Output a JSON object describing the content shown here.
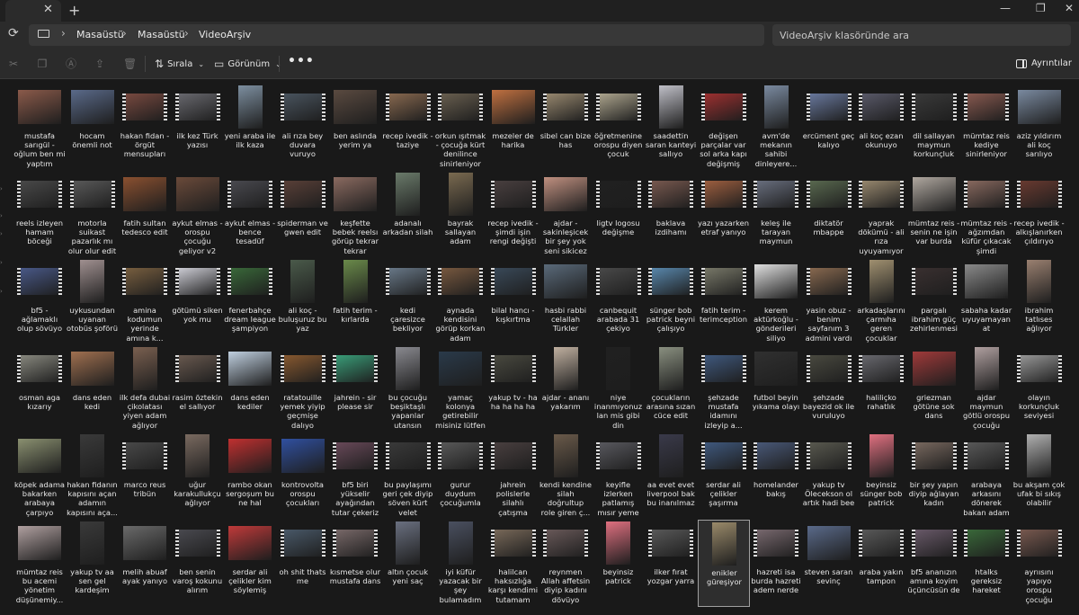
{
  "window": {
    "tab_close": "✕",
    "new_tab": "+",
    "minimize": "—",
    "maximize": "❐",
    "close": "✕"
  },
  "nav": {
    "breadcrumbs": [
      "Masaüstü",
      "Masaüstü",
      "VideoArşiv"
    ],
    "search_placeholder": "VideoArşiv klasöründe ara"
  },
  "toolbar": {
    "sort_label": "Sırala",
    "view_label": "Görünüm",
    "more_label": "•••",
    "details_label": "Ayrıntılar"
  },
  "colors": {
    "background": "#191919",
    "toolbar": "#2b2b2b",
    "address": "#383838",
    "selected_border": "#a0a0a0"
  },
  "files": [
    {
      "name": "mustafa sarıgül - oğlum ben mi yaptım",
      "color": "#8b5a4a",
      "shape": "wide"
    },
    {
      "name": "hocam önemli not",
      "color": "#5a6a8a",
      "shape": "wide"
    },
    {
      "name": "hakan fidan - örgüt mensupları",
      "color": "#7a4a40",
      "shape": "film"
    },
    {
      "name": "ilk kez Türk yazısı",
      "color": "#6a6a70",
      "shape": "film"
    },
    {
      "name": "yeni araba ile ilk kaza",
      "color": "#7d8fa0",
      "shape": "tall"
    },
    {
      "name": "ali rıza bey duvara vuruyo",
      "color": "#4a5560",
      "shape": "film"
    },
    {
      "name": "ben aslında yerim ya",
      "color": "#5a4a40",
      "shape": "wide"
    },
    {
      "name": "recep ivedik - taziye",
      "color": "#8a6a50",
      "shape": "film"
    },
    {
      "name": "orkun ışıtmak - çocuğa kürt denilince sinirleniyor",
      "color": "#6a6050",
      "shape": "film"
    },
    {
      "name": "mezeler de harika",
      "color": "#c07040",
      "shape": "wide"
    },
    {
      "name": "sibel can bize has",
      "color": "#9a8a70",
      "shape": "film"
    },
    {
      "name": "öğretmenine orospu diyen çocuk",
      "color": "#b0a890",
      "shape": "film"
    },
    {
      "name": "saadettin saran kanteyi sallıyo",
      "color": "#c0c0c8",
      "shape": "tall"
    },
    {
      "name": "değişen parçalar var sol arka kapı değişmiş",
      "color": "#a03030",
      "shape": "film"
    },
    {
      "name": "avm'de mekanın sahibi dinleyere...",
      "color": "#7a8aa0",
      "shape": "tall"
    },
    {
      "name": "ercüment geç kalıyo",
      "color": "#6a7aa0",
      "shape": "film"
    },
    {
      "name": "ali koç ezan okunuyo",
      "color": "#5a5a6a",
      "shape": "film"
    },
    {
      "name": "dil sallayan maymun korkunçluk",
      "color": "#3a3a3a",
      "shape": "film"
    },
    {
      "name": "mümtaz reis kediye sinirleniyor",
      "color": "#8a5a50",
      "shape": "film"
    },
    {
      "name": "aziz yıldırım ali koç sarılıyo",
      "color": "#7a8aa0",
      "shape": "wide"
    },
    {
      "name": "reels izleyen hamam böceği",
      "color": "#4a4a4a",
      "shape": "film"
    },
    {
      "name": "motorla suikast pazarlık mı olur olur edit",
      "color": "#5a5a5a",
      "shape": "film"
    },
    {
      "name": "fatih sultan tedesco edit",
      "color": "#8a5030",
      "shape": "wide"
    },
    {
      "name": "aykut elmas - orospu çocuğu geliyor v2",
      "color": "#6a4a3a",
      "shape": "wide"
    },
    {
      "name": "aykut elmas - bence tesadüf",
      "color": "#4a4a50",
      "shape": "film"
    },
    {
      "name": "spiderman ve gwen edit",
      "color": "#5a4038",
      "shape": "film"
    },
    {
      "name": "keşfette bebek reelsı görüp tekrar tekrar izleye...",
      "color": "#8a6a60",
      "shape": "wide"
    },
    {
      "name": "adanalı arkadan silah",
      "color": "#6a7a6a",
      "shape": "tall"
    },
    {
      "name": "bayrak sallayan adam",
      "color": "#7a6a50",
      "shape": "tall"
    },
    {
      "name": "recep ivedik - şimdi işin rengi değişti",
      "color": "#4a4040",
      "shape": "film"
    },
    {
      "name": "ajdar - sakinleşicek bir şey yok seni sikicez",
      "color": "#c09080",
      "shape": "wide"
    },
    {
      "name": "ligtv logosu değişme",
      "color": "#202020",
      "shape": "film"
    },
    {
      "name": "baklava izdihamı",
      "color": "#7a5a50",
      "shape": "film"
    },
    {
      "name": "yazı yazarken etraf yanıyo",
      "color": "#a06040",
      "shape": "film"
    },
    {
      "name": "keleş ile tarayan maymun",
      "color": "#6a7080",
      "shape": "film"
    },
    {
      "name": "diktatör mbappe",
      "color": "#5a6a50",
      "shape": "film"
    },
    {
      "name": "yaprak dökümü - ali rıza uyuyamıyor",
      "color": "#9a8a70",
      "shape": "film"
    },
    {
      "name": "mümtaz reis - senin ne işin var burda",
      "color": "#b0a8a0",
      "shape": "wide"
    },
    {
      "name": "mümtaz reis - ağzımdan küfür çıkacak şimdi",
      "color": "#8a6a60",
      "shape": "film"
    },
    {
      "name": "recep ivedik - alkışlanırken çıldırıyo",
      "color": "#6a3a30",
      "shape": "film"
    },
    {
      "name": "bf5 - ağlamaklı olup sövüyo",
      "color": "#4a5a8a",
      "shape": "film"
    },
    {
      "name": "uykusundan uyanan otobüs şoförü",
      "color": "#a09090",
      "shape": "tall"
    },
    {
      "name": "amina kodumun yerinde amına k...",
      "color": "#7a6040",
      "shape": "film"
    },
    {
      "name": "götümü siken yok mu",
      "color": "#d0d0d8",
      "shape": "film"
    },
    {
      "name": "fenerbahçe dream league şampiyon",
      "color": "#3a6a3a",
      "shape": "film"
    },
    {
      "name": "ali koç - buluşuruz bu yaz",
      "color": "#4a5a4a",
      "shape": "tall"
    },
    {
      "name": "fatih terim - kırlarda",
      "color": "#6a8a4a",
      "shape": "tall"
    },
    {
      "name": "kedi çaresizce bekliyor",
      "color": "#6a7a8a",
      "shape": "film"
    },
    {
      "name": "aynada kendisini görüp korkan adam",
      "color": "#7a5a40",
      "shape": "film"
    },
    {
      "name": "bilal hancı - kışkırtma",
      "color": "#3a4a5a",
      "shape": "film"
    },
    {
      "name": "hasbi rabbi celallah Türkler",
      "color": "#5a6a7a",
      "shape": "wide"
    },
    {
      "name": "canbequit arabada 31 çekiyo",
      "color": "#4a4a4a",
      "shape": "film"
    },
    {
      "name": "sünger bob patrick beyni çalışıyo",
      "color": "#5a8ab0",
      "shape": "film"
    },
    {
      "name": "fatih terim - terimception",
      "color": "#7a7a6a",
      "shape": "film"
    },
    {
      "name": "kerem aktürkoğlu - gönderileri siliyo",
      "color": "#e0e0e0",
      "shape": "wide"
    },
    {
      "name": "yasin obuz - benim sayfanım 3 admini vardı",
      "color": "#8a6a50",
      "shape": "film"
    },
    {
      "name": "arkadaşlarını çarmıha geren çocuklar",
      "color": "#a09070",
      "shape": "tall"
    },
    {
      "name": "pargalı ibrahim güç zehirlenmesi",
      "color": "#3a3030",
      "shape": "film"
    },
    {
      "name": "sabaha kadar uyuyamayan at",
      "color": "#8a8a8a",
      "shape": "wide"
    },
    {
      "name": "ibrahim tatlıses ağlıyor",
      "color": "#9a8070",
      "shape": "tall"
    },
    {
      "name": "osman aga kızarıy",
      "color": "#8a8a80",
      "shape": "film"
    },
    {
      "name": "dans eden kedi",
      "color": "#a07050",
      "shape": "wide"
    },
    {
      "name": "ilk defa dubai çikolatası yiyen adam ağlıyor",
      "color": "#7a6050",
      "shape": "tall"
    },
    {
      "name": "rasim öztekin el sallıyor",
      "color": "#6a5a50",
      "shape": "film"
    },
    {
      "name": "dans eden kediler",
      "color": "#c0d0e0",
      "shape": "wide"
    },
    {
      "name": "ratatouille yemek yiyip geçmişe dalıyo",
      "color": "#8a5a30",
      "shape": "film"
    },
    {
      "name": "jahrein - sir please sir",
      "color": "#3aa07a",
      "shape": "film"
    },
    {
      "name": "bu çocuğu beşiktaşlı yapanlar utansın",
      "color": "#8a8a90",
      "shape": "tall"
    },
    {
      "name": "yamaç kolonya getirebilir misiniz lütfen",
      "color": "#2a3a4a",
      "shape": "wide"
    },
    {
      "name": "yakup tv - ha ha ha ha ha",
      "color": "#4a4a40",
      "shape": "film"
    },
    {
      "name": "ajdar - ananı yakarım",
      "color": "#c0b0a0",
      "shape": "tall"
    },
    {
      "name": "niye inanmıyonuz lan mis gibi din",
      "color": "#202020",
      "shape": "tall"
    },
    {
      "name": "çocukların arasına sızan cüce edit",
      "color": "#8a9080",
      "shape": "tall"
    },
    {
      "name": "şehzade mustafa idamını izleyip a...",
      "color": "#405a80",
      "shape": "film"
    },
    {
      "name": "futbol beyin yıkama olayı",
      "color": "#303030",
      "shape": "wide"
    },
    {
      "name": "şehzade bayezid ok ile vuruluyo",
      "color": "#4a4a40",
      "shape": "film"
    },
    {
      "name": "haliliçko rahatlık",
      "color": "#6a6a70",
      "shape": "film"
    },
    {
      "name": "griezman götüne sok dans",
      "color": "#a03a3a",
      "shape": "wide"
    },
    {
      "name": "ajdar maymun götlü orospu çocuğu",
      "color": "#b0a0a0",
      "shape": "tall"
    },
    {
      "name": "olayın korkunçluk seviyesi",
      "color": "#9a9a9a",
      "shape": "film"
    },
    {
      "name": "köpek adama bakarken arabaya çarpıyo",
      "color": "#8a9070",
      "shape": "wide"
    },
    {
      "name": "hakan fidanın kapısını açan adamın kapısını aça...",
      "color": "#3a3a3a",
      "shape": "tall"
    },
    {
      "name": "marco reus tribün",
      "color": "#4a4a4a",
      "shape": "film"
    },
    {
      "name": "uğur karakullukçu ağlıyor",
      "color": "#7a6a60",
      "shape": "tall"
    },
    {
      "name": "rambo okan sergoşum bu ne hal",
      "color": "#c03030",
      "shape": "wide"
    },
    {
      "name": "kontrovolta orospu çocukları",
      "color": "#3050a0",
      "shape": "wide"
    },
    {
      "name": "bf5 biri yükselir ayağından tutar çekeriz",
      "color": "#6a4a5a",
      "shape": "film"
    },
    {
      "name": "bu paylaşımı geri çek diyip söven kürt velet",
      "color": "#3a3a3a",
      "shape": "film"
    },
    {
      "name": "gurur duydum çocuğumla",
      "color": "#5a5a5a",
      "shape": "film"
    },
    {
      "name": "jahrein polislerle silahlı çatışma",
      "color": "#4a4040",
      "shape": "film"
    },
    {
      "name": "kendi kendine silah doğrultup role giren ç...",
      "color": "#6a5a4a",
      "shape": "tall"
    },
    {
      "name": "keyifle izlerken patlamış mısır yeme",
      "color": "#5a5a60",
      "shape": "film"
    },
    {
      "name": "aa evet evet liverpool bak bu inanılmaz",
      "color": "#3a3a4a",
      "shape": "tall"
    },
    {
      "name": "serdar ali çelikler şaşırma",
      "color": "#405a80",
      "shape": "film"
    },
    {
      "name": "homelander bakış",
      "color": "#4a5a7a",
      "shape": "film"
    },
    {
      "name": "yakup tv Ölecekson ol artık hadi bee",
      "color": "#5a5a50",
      "shape": "film"
    },
    {
      "name": "beyinsiz sünger bob patrick",
      "color": "#e07080",
      "shape": "tall"
    },
    {
      "name": "bir şey yapın diyip ağlayan kadın",
      "color": "#7a6a60",
      "shape": "film"
    },
    {
      "name": "arabaya arkasını dönerek bakan adam",
      "color": "#5a5a5a",
      "shape": "film"
    },
    {
      "name": "bu akşam çok ufak bi sıkış olabilir",
      "color": "#b0b0b0",
      "shape": "tall"
    },
    {
      "name": "mümtaz reis bu acemi yönetim düşünemiy...",
      "color": "#b0a0a0",
      "shape": "wide"
    },
    {
      "name": "yakup tv aa sen gel kardeşim",
      "color": "#3a3a3a",
      "shape": "tall"
    },
    {
      "name": "melih abuaf ayak yanıyo",
      "color": "#6a6a6a",
      "shape": "wide"
    },
    {
      "name": "ben senin varoş kokunu alırım",
      "color": "#4a4a50",
      "shape": "film"
    },
    {
      "name": "serdar ali çelikler kim söylemiş",
      "color": "#c03a3a",
      "shape": "wide"
    },
    {
      "name": "oh shit thats me",
      "color": "#4a5a6a",
      "shape": "film"
    },
    {
      "name": "kısmetse olur mustafa dans",
      "color": "#7a6a6a",
      "shape": "film"
    },
    {
      "name": "altın çocuk yeni saç",
      "color": "#6a7080",
      "shape": "tall"
    },
    {
      "name": "iyi küfür yazacak bir şey bulamadım",
      "color": "#4a5060",
      "shape": "tall"
    },
    {
      "name": "halilcan haksızlığa karşı kendimi tutamam",
      "color": "#7a6a5a",
      "shape": "film"
    },
    {
      "name": "reynmen Allah affetsin diyip kadını dövüyo",
      "color": "#6a5a5a",
      "shape": "film"
    },
    {
      "name": "beyinsiz patrick",
      "color": "#e07080",
      "shape": "tall"
    },
    {
      "name": "ilker fırat yozgar yarra",
      "color": "#5a5a5a",
      "shape": "film"
    },
    {
      "name": "enikler güreşiyor",
      "color": "#9a8a6a",
      "shape": "tall"
    },
    {
      "name": "hazreti isa burda hazreti adem nerde",
      "color": "#7a6a70",
      "shape": "film"
    },
    {
      "name": "steven saran sevinç",
      "color": "#5a6a8a",
      "shape": "wide"
    },
    {
      "name": "araba yakın tampon",
      "color": "#5a5a5a",
      "shape": "film"
    },
    {
      "name": "bf5 ananızın amına koyim üçüncüsün de",
      "color": "#6a5a6a",
      "shape": "film"
    },
    {
      "name": "htalks gereksiz hareket",
      "color": "#3a6a3a",
      "shape": "film"
    },
    {
      "name": "ayrıısını yapıyo orospu çocuğu",
      "color": "#7a5a50",
      "shape": "film"
    }
  ],
  "selected_index": 113
}
